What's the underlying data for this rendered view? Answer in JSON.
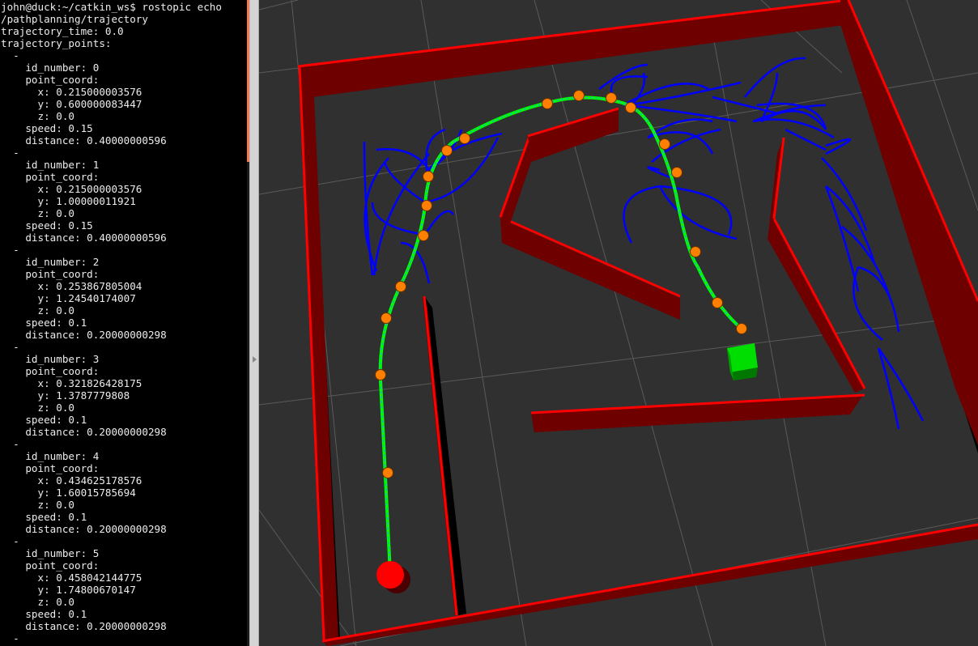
{
  "terminal": {
    "lines": [
      "john@duck:~/catkin_ws$ rostopic echo",
      "/pathplanning/trajectory",
      "trajectory_time: 0.0",
      "trajectory_points:",
      "  -",
      "    id_number: 0",
      "    point_coord:",
      "      x: 0.215000003576",
      "      y: 0.600000083447",
      "      z: 0.0",
      "    speed: 0.15",
      "    distance: 0.40000000596",
      "  -",
      "    id_number: 1",
      "    point_coord:",
      "      x: 0.215000003576",
      "      y: 1.00000011921",
      "      z: 0.0",
      "    speed: 0.15",
      "    distance: 0.40000000596",
      "  -",
      "    id_number: 2",
      "    point_coord:",
      "      x: 0.253867805004",
      "      y: 1.24540174007",
      "      z: 0.0",
      "    speed: 0.1",
      "    distance: 0.20000000298",
      "  -",
      "    id_number: 3",
      "    point_coord:",
      "      x: 0.321826428175",
      "      y: 1.3787779808",
      "      z: 0.0",
      "    speed: 0.1",
      "    distance: 0.20000000298",
      "  -",
      "    id_number: 4",
      "    point_coord:",
      "      x: 0.434625178576",
      "      y: 1.60015785694",
      "      z: 0.0",
      "    speed: 0.1",
      "    distance: 0.20000000298",
      "  -",
      "    id_number: 5",
      "    point_coord:",
      "      x: 0.458042144775",
      "      y: 1.74800670147",
      "      z: 0.0",
      "    speed: 0.1",
      "    distance: 0.20000000298",
      "  -"
    ]
  },
  "viewport": {
    "colors": {
      "background": "#303030",
      "grid": "#5a5a5a",
      "wall_top": "#ff0000",
      "wall_face": "#6e0000",
      "wall_shadow": "#000000",
      "trajectory": "#00ff00",
      "candidate_paths": "#0000ff",
      "waypoint": "#ff8000",
      "start_marker": "#ff0000",
      "goal_marker": "#00dd00"
    },
    "markers": {
      "start_icon": "red-sphere-icon",
      "goal_icon": "green-cube-icon",
      "waypoint_icon": "orange-sphere-icon"
    }
  }
}
